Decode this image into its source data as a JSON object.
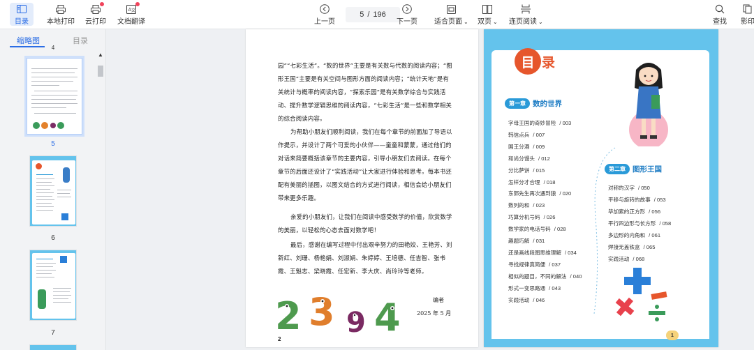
{
  "toolbar": {
    "left": [
      {
        "label": "目录",
        "icon": "sidebar-toc-icon"
      },
      {
        "label": "本地打印",
        "icon": "printer-icon"
      },
      {
        "label": "云打印",
        "icon": "cloud-print-icon"
      },
      {
        "label": "文档翻译",
        "icon": "translate-icon"
      }
    ],
    "prev_label": "上一页",
    "next_label": "下一页",
    "current_page": "5",
    "page_separator": "/",
    "total_pages": "196",
    "fit_page_label": "适合页面",
    "double_page_label": "双页",
    "continuous_label": "连页阅读",
    "search_label": "查找",
    "overflow_label": "影印"
  },
  "sidebar": {
    "tab_thumbnails": "缩略图",
    "tab_toc": "目录",
    "partial_number_top": "4",
    "thumbnails": [
      {
        "number": "5",
        "selected": true
      },
      {
        "number": "6",
        "selected": false
      },
      {
        "number": "7",
        "selected": false
      }
    ]
  },
  "left_page": {
    "paragraphs": [
      "园”“七彩生活”。“数的世界”主要是有关数与代数的阅读内容；“图形王国”主要是有关空间与图形方面的阅读内容；“统计天地”是有关统计与概率的阅读内容，“探索乐园”是有关数学综合与实践活动、提升数学逻辑思维的阅读内容，“七彩生活”是一些和数学相关的综合阅读内容。",
      "为帮助小朋友们顺利阅读，我们在每个章节的前面加了导语以作提示，并设计了两个可爱的小伙伴——童童和蒙蒙，通过他们的对话来简要概括该章节的主要内容，引导小朋友们去阅读。在每个章节的后面还设计了“实践活动”让大家进行体验和思考。每本书还配有美丽的插图，以图文结合的方式进行阅读，相信会给小朋友们带来更多乐趣。",
      "亲爱的小朋友们，让我们在阅读中感受数学的价值，欣赏数学的美丽，以轻松的心态去面对数学吧！",
      "最后，感谢在编写过程中付出艰辛努力的田艳姣、王艳芳、刘新红、刘珊、杨艳娟、刘淑娟、朱婷婷、王培德、任吉智、张书霞、王魁志、梁晓霞、任宏新、李大庆、尚玲玲等老师。"
    ],
    "author": "编者",
    "date": "2025 年 5 月",
    "page_number": "2"
  },
  "right_page": {
    "title_char1": "目",
    "title_char2": "录",
    "chapter1": {
      "tag": "第一章",
      "title": "数的世界"
    },
    "chapter1_items": [
      {
        "title": "字母王国的奇妙冒险",
        "page": "/ 003"
      },
      {
        "title": "韩信点兵",
        "page": "/ 007"
      },
      {
        "title": "国王分酒",
        "page": "/ 009"
      },
      {
        "title": "和尚分馒头",
        "page": "/ 012"
      },
      {
        "title": "分比萨饼",
        "page": "/ 015"
      },
      {
        "title": "怎样分才合理",
        "page": "/ 018"
      },
      {
        "title": "东郭先生再次遇到狼",
        "page": "/ 020"
      },
      {
        "title": "数列的和",
        "page": "/ 023"
      },
      {
        "title": "巧算分机号码",
        "page": "/ 026"
      },
      {
        "title": "数学家的电话号码",
        "page": "/ 028"
      },
      {
        "title": "趣题巧解",
        "page": "/ 031"
      },
      {
        "title": "还是画线段图思维理解",
        "page": "/ 034"
      },
      {
        "title": "寻找规律真简便",
        "page": "/ 037"
      },
      {
        "title": "相似的题目，不同的解法",
        "page": "/ 040"
      },
      {
        "title": "形式一变思路通",
        "page": "/ 043"
      },
      {
        "title": "实践活动",
        "page": "/ 046"
      }
    ],
    "chapter2": {
      "tag": "第二章",
      "title": "图形王国"
    },
    "chapter2_items": [
      {
        "title": "对称的汉字",
        "page": "/ 050"
      },
      {
        "title": "平移与旋转的故事",
        "page": "/ 053"
      },
      {
        "title": "毕加索的正方形",
        "page": "/ 056"
      },
      {
        "title": "平行四边形与长方形",
        "page": "/ 058"
      },
      {
        "title": "多边形的内角和",
        "page": "/ 061"
      },
      {
        "title": "焊接无盖铁盒",
        "page": "/ 065"
      },
      {
        "title": "实践活动",
        "page": "/ 068"
      }
    ],
    "page_number": "1"
  },
  "colors": {
    "accent": "#2b6de5",
    "badge_red": "#f0435b",
    "toc_bg": "#64c3ec",
    "chapter_blue": "#2a9ad8",
    "mulu_orange": "#e6562c"
  }
}
